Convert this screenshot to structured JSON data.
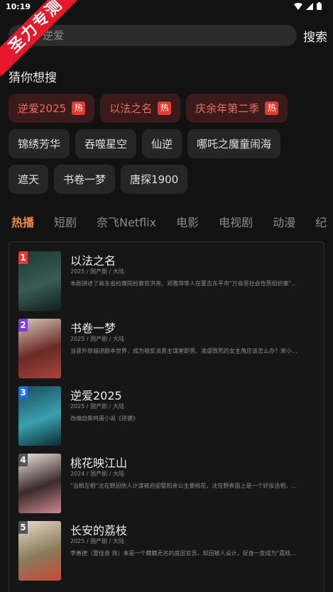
{
  "status": {
    "time": "10:19"
  },
  "ribbon": {
    "text": "圣力专测"
  },
  "search": {
    "value": "逆爱",
    "button_label": "搜索"
  },
  "suggest": {
    "title": "猜你想搜",
    "hot_badge": "热",
    "rows": [
      [
        {
          "label": "逆爱2025",
          "hot": true
        },
        {
          "label": "以法之名",
          "hot": true
        },
        {
          "label": "庆余年第二季",
          "hot": true
        }
      ],
      [
        {
          "label": "锦绣芳华"
        },
        {
          "label": "吞噬星空"
        },
        {
          "label": "仙逆"
        },
        {
          "label": "哪吒之魔童闹海"
        }
      ],
      [
        {
          "label": "遮天"
        },
        {
          "label": "书卷一梦"
        },
        {
          "label": "唐探1900"
        }
      ]
    ]
  },
  "tabs": [
    {
      "label": "热播",
      "active": true
    },
    {
      "label": "短剧"
    },
    {
      "label": "奈飞Netflix"
    },
    {
      "label": "电影"
    },
    {
      "label": "电视剧"
    },
    {
      "label": "动漫"
    },
    {
      "label": "纪"
    }
  ],
  "ranking": [
    {
      "rank": "1",
      "badge_color": "#e53935",
      "title": "以法之名",
      "meta": "2025 / 国产剧 / 大陆",
      "desc": "本剧讲述了商东省检察院检察官洪亮、郑雅萍等人在夏吉东平市\"万商恩社会性质组织案\"...",
      "poster": [
        "#1c3a3a",
        "#0e2020",
        "#3b5a52"
      ]
    },
    {
      "rank": "2",
      "badge_color": "#7b3fd6",
      "title": "书卷一梦",
      "meta": "2025 / 国产剧 / 大陆",
      "desc": "当意外穿越进剧本世界，成为被反派男主谋害即男、凌虐致死的女主角应该怎么办？宋小...",
      "poster": [
        "#d8c8bc",
        "#a8443c",
        "#6b2a26"
      ]
    },
    {
      "rank": "3",
      "badge_color": "#1e6fd6",
      "title": "逆爱2025",
      "meta": "2025 / 国产剧 / 大陆",
      "desc": "改编自柴鸡蛋小说《逆袭》",
      "poster": [
        "#1a4a5a",
        "#0a2a33",
        "#3aa0b0"
      ]
    },
    {
      "rank": "4",
      "badge_color": "#555555",
      "title": "桃花映江山",
      "meta": "2024 / 国产剧 / 大陆",
      "desc": "\"当朝左相\"沈在野因他人计谋被迫迎娶和亲公主姜桃花，沈在野表面上是一个奸佞丞相，...",
      "poster": [
        "#efe6e0",
        "#d08a90",
        "#3a2a2a"
      ]
    },
    {
      "rank": "5",
      "badge_color": "#555555",
      "title": "长安的荔枝",
      "meta": "2025 / 国产剧 / 大陆",
      "desc": "李善德（雷佳音 饰）本是一个籍籍无名的底层官员，却因被人设计，捉身一变成为\"荔枝...",
      "poster": [
        "#e6dccc",
        "#c84a3a",
        "#8a7a5a"
      ]
    }
  ]
}
